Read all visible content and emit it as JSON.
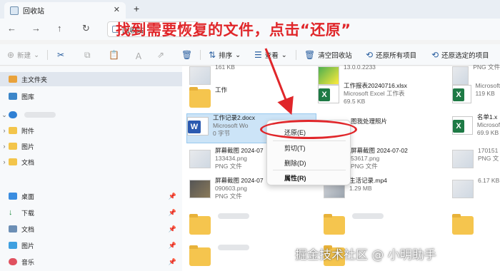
{
  "window": {
    "tab_title": "回收站",
    "tab_close": "✕",
    "new_tab": "+"
  },
  "nav": {
    "back": "←",
    "forward": "→",
    "up": "↑",
    "refresh": "↻",
    "address": "回收站"
  },
  "toolbar": {
    "new_label": "新建",
    "sort_label": "排序",
    "view_label": "查看",
    "empty_bin_label": "清空回收站",
    "restore_all_label": "还原所有项目",
    "restore_selected_label": "还原选定的项目"
  },
  "sidebar": {
    "items": [
      {
        "label": "主文件夹"
      },
      {
        "label": "图库"
      },
      {
        "label": ""
      },
      {
        "label": "附件"
      },
      {
        "label": "图片"
      },
      {
        "label": "文档"
      },
      {
        "label": "桌面"
      },
      {
        "label": "下载"
      },
      {
        "label": "文档"
      },
      {
        "label": "图片"
      },
      {
        "label": "音乐"
      }
    ]
  },
  "files": [
    {
      "name": "",
      "sub": "161 KB",
      "icon": "thumb"
    },
    {
      "name": "",
      "sub": "13.0.0.2233",
      "icon": "green"
    },
    {
      "name": "",
      "sub": "PNG 文件",
      "icon": "thumb"
    },
    {
      "name": "工作",
      "sub": "",
      "icon": "folder"
    },
    {
      "name": "工作报表20240716.xlsx",
      "sub": "Microsoft Excel 工作表",
      "sub2": "69.5 KB",
      "icon": "excel"
    },
    {
      "name": "",
      "sub": "Microsoft",
      "sub2": "119 KB",
      "icon": "excel"
    },
    {
      "name": "工作记录2.docx",
      "sub": "Microsoft Wo",
      "sub2": "0 字节",
      "icon": "word"
    },
    {
      "name": "图我处理照片",
      "sub": "",
      "icon": "thumb"
    },
    {
      "name": "名单1.x",
      "sub": "Microsof",
      "sub2": "69.9 KB",
      "icon": "excel"
    },
    {
      "name": "屏幕截图 2024-07",
      "sub": "133434.png",
      "sub2": "PNG 文件",
      "icon": "thumb"
    },
    {
      "name": "屏幕截图 2024-07-02",
      "sub": "53617.png",
      "sub2": "PNG 文件",
      "icon": "thumb"
    },
    {
      "name": "",
      "sub": "170151",
      "sub2": "PNG 文",
      "icon": "thumb"
    },
    {
      "name": "屏幕截图 2024-07",
      "sub": "090603.png",
      "sub2": "PNG 文件",
      "icon": "dark"
    },
    {
      "name": "生活记录.mp4",
      "sub": "",
      "sub2": "1.29 MB",
      "icon": "film"
    },
    {
      "name": "",
      "sub": "",
      "sub2": "6.17 KB",
      "icon": "thumb"
    }
  ],
  "context_menu": {
    "items": [
      {
        "label": "还原(E)"
      },
      {
        "label": "剪切(T)"
      },
      {
        "label": "删除(D)"
      },
      {
        "label": "属性(R)"
      }
    ]
  },
  "annotation": {
    "headline": "找到需要恢复的文件，点击“还原”",
    "watermark": "掘金技术社区 @ 小明助手",
    "color": "#e0262a"
  },
  "colors": {
    "accent": "#2a5fa0",
    "selection": "#cce4f7",
    "annotation_red": "#e0262a"
  }
}
